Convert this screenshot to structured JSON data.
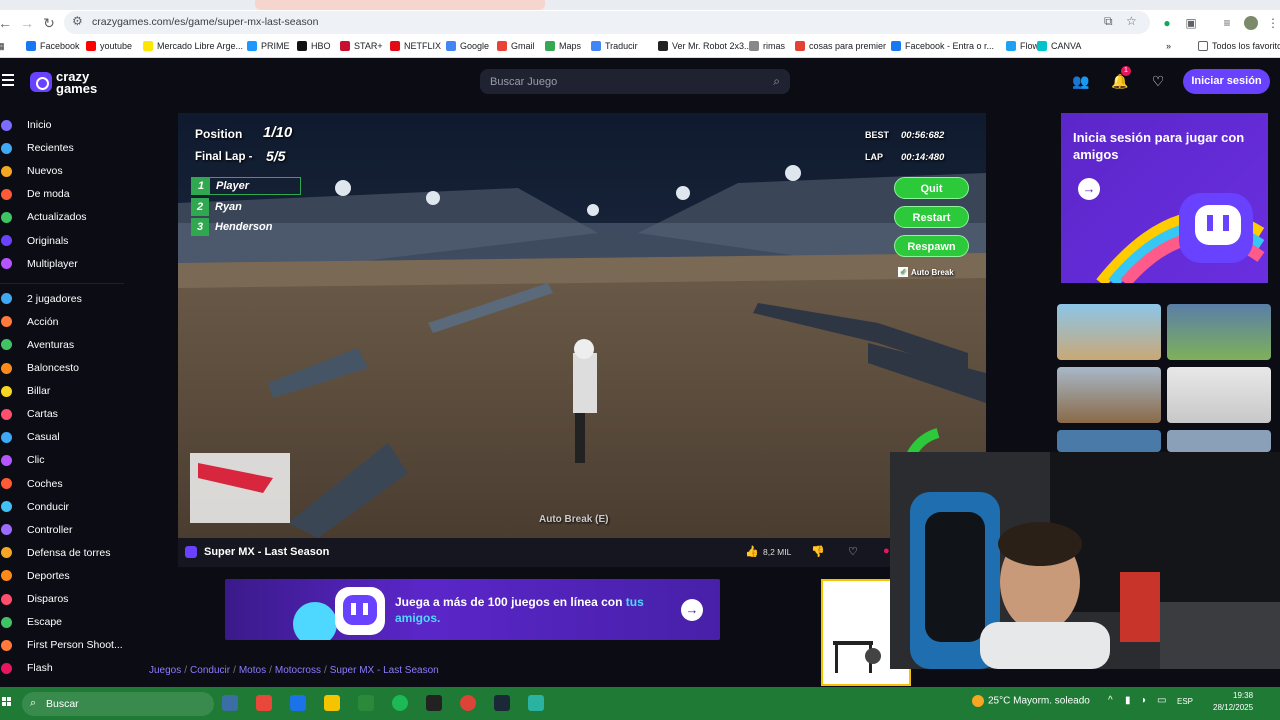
{
  "browser": {
    "url": "crazygames.com/es/game/super-mx-last-season",
    "bookmarks": [
      {
        "label": "Facebook",
        "color": "#1877f2"
      },
      {
        "label": "youtube",
        "color": "#ff0000"
      },
      {
        "label": "Mercado Libre Arge...",
        "color": "#ffe600"
      },
      {
        "label": "PRIME",
        "color": "#1a98ff"
      },
      {
        "label": "HBO",
        "color": "#111111"
      },
      {
        "label": "STAR+",
        "color": "#c8102e"
      },
      {
        "label": "NETFLIX",
        "color": "#e50914"
      },
      {
        "label": "Google",
        "color": "#4285f4"
      },
      {
        "label": "Gmail",
        "color": "#ea4335"
      },
      {
        "label": "Maps",
        "color": "#34a853"
      },
      {
        "label": "Traducir",
        "color": "#4285f4"
      },
      {
        "label": "Ver Mr. Robot 2x3...",
        "color": "#222222"
      },
      {
        "label": "rimas",
        "color": "#888888"
      },
      {
        "label": "cosas para premier",
        "color": "#e34133"
      },
      {
        "label": "Facebook - Entra o r...",
        "color": "#1877f2"
      },
      {
        "label": "Flow",
        "color": "#1da1f2"
      },
      {
        "label": "CANVA",
        "color": "#00c4cc"
      }
    ],
    "all_bookmarks": "Todos los favoritos"
  },
  "site": {
    "logo_line1": "crazy",
    "logo_line2": "games",
    "search_placeholder": "Buscar Juego",
    "notif_count": "1",
    "login_label": "Iniciar sesión"
  },
  "sidebar": {
    "items": [
      {
        "label": "Inicio",
        "color": "#7b6cff"
      },
      {
        "label": "Recientes",
        "color": "#3fa9f5"
      },
      {
        "label": "Nuevos",
        "color": "#f5a623"
      },
      {
        "label": "De moda",
        "color": "#ff5a36"
      },
      {
        "label": "Actualizados",
        "color": "#40c463"
      },
      {
        "label": "Originals",
        "color": "#6842ff"
      },
      {
        "label": "Multiplayer",
        "color": "#b455ff"
      },
      {
        "label": "2 jugadores",
        "color": "#3fa9f5"
      },
      {
        "label": "Acción",
        "color": "#ff7a3d"
      },
      {
        "label": "Aventuras",
        "color": "#40c463"
      },
      {
        "label": "Baloncesto",
        "color": "#ff8a1a"
      },
      {
        "label": "Billar",
        "color": "#f5d623"
      },
      {
        "label": "Cartas",
        "color": "#ff4f6d"
      },
      {
        "label": "Casual",
        "color": "#3fa9f5"
      },
      {
        "label": "Clic",
        "color": "#b455ff"
      },
      {
        "label": "Coches",
        "color": "#ff5a36"
      },
      {
        "label": "Conducir",
        "color": "#3fc1f5"
      },
      {
        "label": "Controller",
        "color": "#9b6cff"
      },
      {
        "label": "Defensa de torres",
        "color": "#f5a623"
      },
      {
        "label": "Deportes",
        "color": "#ff8a1a"
      },
      {
        "label": "Disparos",
        "color": "#ff4f6d"
      },
      {
        "label": "Escape",
        "color": "#40c463"
      },
      {
        "label": "First Person Shoot...",
        "color": "#ff7a3d"
      },
      {
        "label": "Flash",
        "color": "#e8175d"
      }
    ]
  },
  "game": {
    "position_label": "Position",
    "position_value": "1/10",
    "lap_label": "Final Lap -",
    "lap_value": "5/5",
    "ranks": [
      {
        "num": "1",
        "name": "Player"
      },
      {
        "num": "2",
        "name": "Ryan"
      },
      {
        "num": "3",
        "name": "Henderson"
      }
    ],
    "best_label": "BEST",
    "best_time": "00:56:682",
    "lap_time_label": "LAP",
    "lap_time": "00:14:480",
    "buttons": [
      "Quit",
      "Restart",
      "Respawn"
    ],
    "auto_break_toggle": "Auto Break",
    "auto_break_hint": "Auto Break (E)",
    "title": "Super MX - Last Season",
    "likes": "8,2 MIL"
  },
  "promo": {
    "line1_a": "Juega a más de 100 juegos en línea con",
    "line1_b": "tus",
    "line2": "amigos."
  },
  "breadcrumb": [
    "Juegos",
    "Conducir",
    "Motos",
    "Motocross",
    "Super MX - Last Season"
  ],
  "right": {
    "signin_title": "Inicia sesión para jugar con amigos"
  },
  "taskbar": {
    "search": "Buscar",
    "weather": "25°C  Mayorm. soleado",
    "lang": "ESP",
    "time": "19:38",
    "date": "28/12/2025"
  }
}
